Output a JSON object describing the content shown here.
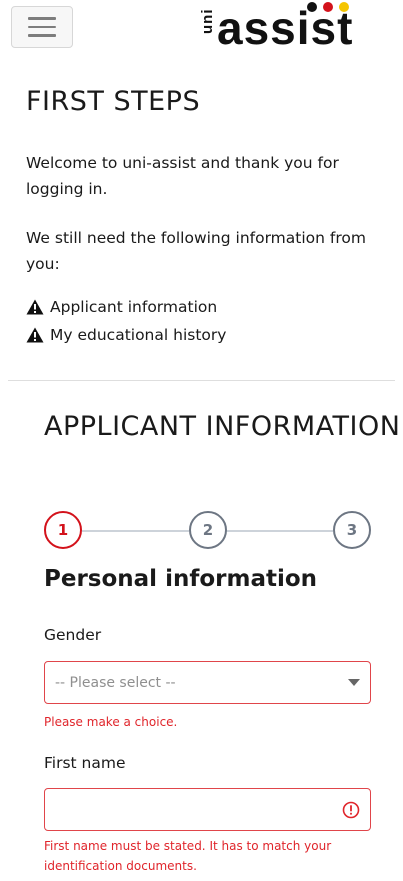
{
  "header": {
    "menu_icon": "hamburger-menu-icon",
    "logo_prefix": "uni",
    "logo_word": "assist",
    "logo_dot_colors": [
      "#111111",
      "#d3121b",
      "#f5c500"
    ]
  },
  "first_steps": {
    "title": "FIRST STEPS",
    "welcome": "Welcome to uni-assist and thank you for logging in.",
    "need_info": "We still need the following information from you:",
    "requirements": [
      "Applicant information",
      "My educational history"
    ],
    "requirement_icon": "warning-triangle-icon"
  },
  "applicant": {
    "title": "APPLICANT INFORMATION",
    "steps": [
      "1",
      "2",
      "3"
    ],
    "active_step": 1,
    "section_title": "Personal information",
    "gender": {
      "label": "Gender",
      "placeholder": "-- Please select --",
      "error": "Please make a choice."
    },
    "first_name": {
      "label": "First name",
      "value": "",
      "error": "First name must be stated. It has to match your identification documents."
    }
  },
  "colors": {
    "brand_red": "#d3121b",
    "error_red": "#e0252b",
    "step_gray": "#6d7683"
  }
}
